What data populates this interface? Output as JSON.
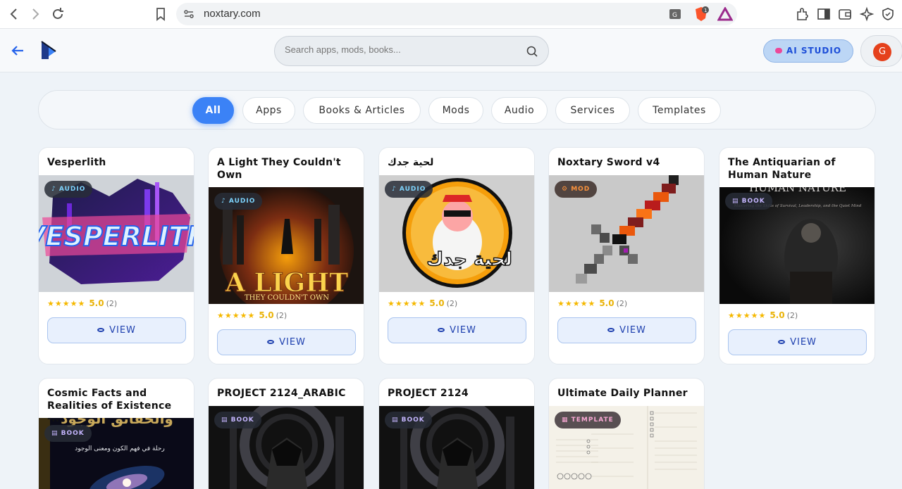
{
  "browser": {
    "url": "noxtary.com",
    "brave_badge_count": "1"
  },
  "header": {
    "search_placeholder": "Search apps, mods, books...",
    "ai_studio_label": "AI STUDIO",
    "avatar_initial": "G"
  },
  "filters": [
    {
      "label": "All",
      "active": true
    },
    {
      "label": "Apps"
    },
    {
      "label": "Books & Articles"
    },
    {
      "label": "Mods"
    },
    {
      "label": "Audio"
    },
    {
      "label": "Services"
    },
    {
      "label": "Templates"
    }
  ],
  "cards": [
    {
      "title": "Vesperlith",
      "badge": "AUDIO",
      "rating_stars": "★★★★★",
      "rating": "5.0",
      "count": "(2)",
      "view_label": "VIEW"
    },
    {
      "title": "A Light They Couldn't Own",
      "badge": "AUDIO",
      "rating_stars": "★★★★★",
      "rating": "5.0",
      "count": "(2)",
      "view_label": "VIEW",
      "image_text": "A LIGHT",
      "image_subtext": "THEY COULDN'T OWN"
    },
    {
      "title": "لحية جدك",
      "badge": "AUDIO",
      "rating_stars": "★★★★★",
      "rating": "5.0",
      "count": "(2)",
      "view_label": "VIEW",
      "image_text": "لحية جدك"
    },
    {
      "title": "Noxtary Sword v4",
      "badge": "MOD",
      "rating_stars": "★★★★★",
      "rating": "5.0",
      "count": "(2)",
      "view_label": "VIEW"
    },
    {
      "title": "The Antiquarian of Human Nature",
      "badge": "BOOK",
      "rating_stars": "★★★★★",
      "rating": "5.0",
      "count": "(2)",
      "view_label": "VIEW",
      "image_text": "HUMAN NATURE",
      "image_subtext": "Mastering the Skills of Survival, Leadership, and the Quiet Mind"
    },
    {
      "title": "Cosmic Facts and Realities of Existence -...",
      "badge": "BOOK",
      "image_text": "رحلة في فهم الكون ومعنى الوجود"
    },
    {
      "title": "PROJECT 2124_ARABIC",
      "badge": "BOOK"
    },
    {
      "title": "PROJECT 2124",
      "badge": "BOOK"
    },
    {
      "title": "Ultimate Daily Planner",
      "badge": "TEMPLATE"
    }
  ]
}
